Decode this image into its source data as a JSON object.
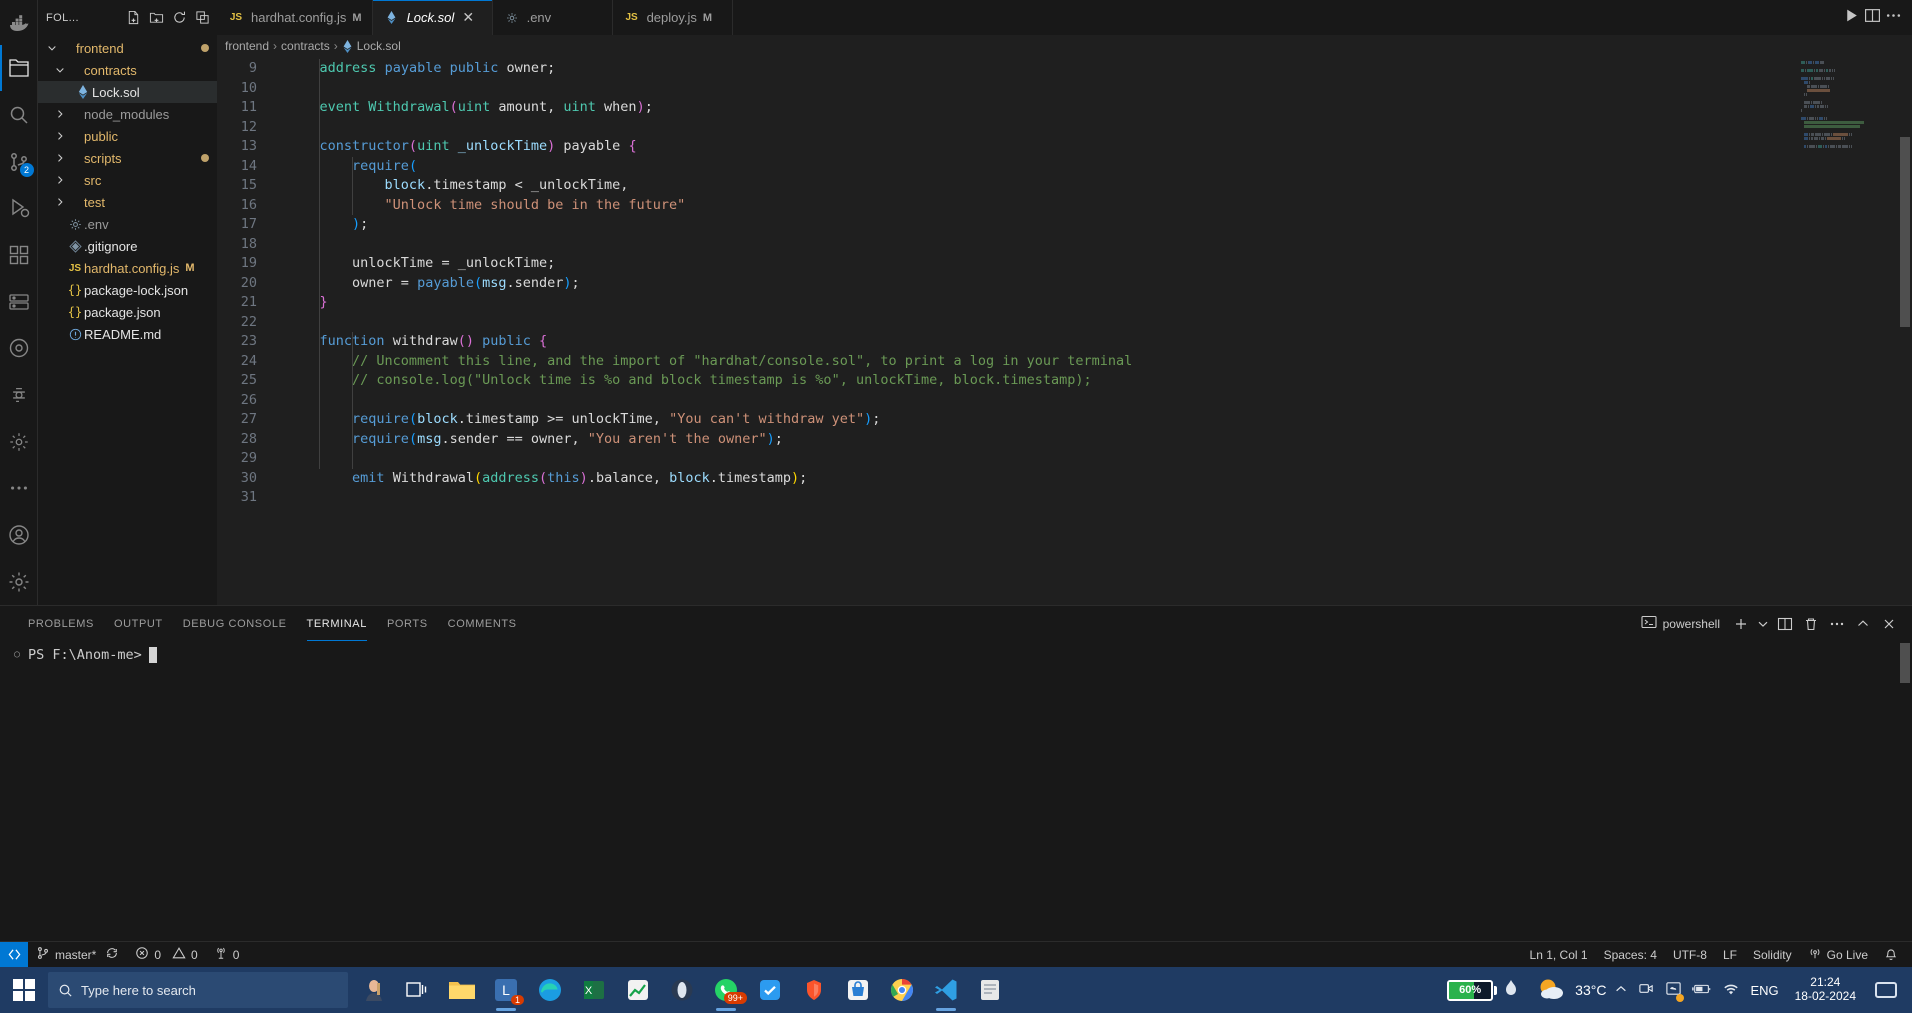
{
  "activity_bar": {
    "items": [
      {
        "name": "docker-icon",
        "label": "Docker"
      },
      {
        "name": "explorer-icon",
        "label": "Explorer"
      },
      {
        "name": "search-icon",
        "label": "Search"
      },
      {
        "name": "source-control-icon",
        "label": "Source Control",
        "badge": "2"
      },
      {
        "name": "run-debug-icon",
        "label": "Run and Debug"
      },
      {
        "name": "extensions-icon",
        "label": "Extensions"
      },
      {
        "name": "remote-explorer-icon",
        "label": "Remote Explorer"
      },
      {
        "name": "testing-icon",
        "label": "Testing"
      },
      {
        "name": "figma-icon",
        "label": "Figma"
      },
      {
        "name": "settings-gear-icon",
        "label": "Settings"
      },
      {
        "name": "more-actions-icon",
        "label": "More Actions"
      },
      {
        "name": "accounts-icon",
        "label": "Accounts"
      },
      {
        "name": "manage-icon",
        "label": "Manage"
      }
    ]
  },
  "sidebar": {
    "title": "FOL...",
    "actions": [
      {
        "name": "new-file-button",
        "label": "New File"
      },
      {
        "name": "new-folder-button",
        "label": "New Folder"
      },
      {
        "name": "refresh-explorer-button",
        "label": "Refresh Explorer"
      },
      {
        "name": "collapse-folders-button",
        "label": "Collapse Folders"
      }
    ],
    "tree": [
      {
        "label": "frontend",
        "depth": 0,
        "kind": "folder",
        "state": "expanded",
        "dirty": true,
        "mod": ""
      },
      {
        "label": "contracts",
        "depth": 1,
        "kind": "folder",
        "state": "expanded",
        "dirty": false,
        "mod": ""
      },
      {
        "label": "Lock.sol",
        "depth": 2,
        "kind": "solidity",
        "state": "file",
        "dirty": false,
        "mod": "",
        "selected": true
      },
      {
        "label": "node_modules",
        "depth": 1,
        "kind": "folder",
        "state": "collapsed",
        "dirty": false,
        "mod": ""
      },
      {
        "label": "public",
        "depth": 1,
        "kind": "folder",
        "state": "collapsed",
        "dirty": false,
        "mod": ""
      },
      {
        "label": "scripts",
        "depth": 1,
        "kind": "folder",
        "state": "collapsed",
        "dirty": true,
        "mod": ""
      },
      {
        "label": "src",
        "depth": 1,
        "kind": "folder",
        "state": "collapsed",
        "dirty": false,
        "mod": ""
      },
      {
        "label": "test",
        "depth": 1,
        "kind": "folder",
        "state": "collapsed",
        "dirty": false,
        "mod": ""
      },
      {
        "label": ".env",
        "depth": 1,
        "kind": "env",
        "state": "file",
        "dirty": false,
        "mod": ""
      },
      {
        "label": ".gitignore",
        "depth": 1,
        "kind": "git",
        "state": "file",
        "dirty": false,
        "mod": ""
      },
      {
        "label": "hardhat.config.js",
        "depth": 1,
        "kind": "js",
        "state": "file",
        "dirty": false,
        "mod": "M"
      },
      {
        "label": "package-lock.json",
        "depth": 1,
        "kind": "json",
        "state": "file",
        "dirty": false,
        "mod": ""
      },
      {
        "label": "package.json",
        "depth": 1,
        "kind": "json",
        "state": "file",
        "dirty": false,
        "mod": ""
      },
      {
        "label": "README.md",
        "depth": 1,
        "kind": "md",
        "state": "file",
        "dirty": false,
        "mod": ""
      }
    ]
  },
  "editor": {
    "tabs": [
      {
        "label": "hardhat.config.js",
        "icon": "js-icon",
        "mod": "M",
        "active": false,
        "italic": false,
        "closable": false
      },
      {
        "label": "Lock.sol",
        "icon": "solidity-icon",
        "mod": "",
        "active": true,
        "italic": true,
        "closable": true
      },
      {
        "label": ".env",
        "icon": "gear-icon",
        "mod": "",
        "active": false,
        "italic": false,
        "closable": false
      },
      {
        "label": "deploy.js",
        "icon": "js-icon",
        "mod": "M",
        "active": false,
        "italic": false,
        "closable": false
      }
    ],
    "tab_actions": [
      {
        "name": "run-file-button",
        "label": "Run"
      },
      {
        "name": "split-editor-button",
        "label": "Split Editor Right"
      },
      {
        "name": "more-actions-button",
        "label": "More Actions..."
      }
    ],
    "breadcrumb": [
      "frontend",
      "contracts",
      "Lock.sol"
    ],
    "first_line": 9,
    "lines": [
      {
        "n": 9,
        "indent": 1,
        "tokens": [
          {
            "t": "address",
            "c": "t-type"
          },
          {
            "t": " ",
            "c": "t-plain"
          },
          {
            "t": "payable",
            "c": "t-ctrl"
          },
          {
            "t": " ",
            "c": "t-plain"
          },
          {
            "t": "public",
            "c": "t-ctrl"
          },
          {
            "t": " owner;",
            "c": "t-id"
          }
        ]
      },
      {
        "n": 10,
        "indent": 0,
        "tokens": []
      },
      {
        "n": 11,
        "indent": 1,
        "tokens": [
          {
            "t": "event",
            "c": "t-type"
          },
          {
            "t": " ",
            "c": "t-plain"
          },
          {
            "t": "Withdrawal",
            "c": "t-type"
          },
          {
            "t": "(",
            "c": "t-p2"
          },
          {
            "t": "uint",
            "c": "t-type"
          },
          {
            "t": " amount",
            "c": "t-id"
          },
          {
            "t": ", ",
            "c": "t-id"
          },
          {
            "t": "uint",
            "c": "t-type"
          },
          {
            "t": " when",
            "c": "t-id"
          },
          {
            "t": ")",
            "c": "t-p2"
          },
          {
            "t": ";",
            "c": "t-id"
          }
        ]
      },
      {
        "n": 12,
        "indent": 0,
        "tokens": []
      },
      {
        "n": 13,
        "indent": 1,
        "tokens": [
          {
            "t": "constructor",
            "c": "t-ctrl"
          },
          {
            "t": "(",
            "c": "t-p2"
          },
          {
            "t": "uint",
            "c": "t-type"
          },
          {
            "t": " _unlockTime",
            "c": "t-var"
          },
          {
            "t": ")",
            "c": "t-p2"
          },
          {
            "t": " ",
            "c": "t-plain"
          },
          {
            "t": "payable",
            "c": "t-id"
          },
          {
            "t": " ",
            "c": "t-plain"
          },
          {
            "t": "{",
            "c": "t-p2"
          }
        ]
      },
      {
        "n": 14,
        "indent": 2,
        "tokens": [
          {
            "t": "require",
            "c": "t-ctrl"
          },
          {
            "t": "(",
            "c": "t-p3"
          }
        ]
      },
      {
        "n": 15,
        "indent": 3,
        "tokens": [
          {
            "t": "block",
            "c": "t-var"
          },
          {
            "t": ".timestamp",
            "c": "t-id"
          },
          {
            "t": " < ",
            "c": "t-id"
          },
          {
            "t": "_unlockTime",
            "c": "t-id"
          },
          {
            "t": ",",
            "c": "t-id"
          }
        ]
      },
      {
        "n": 16,
        "indent": 3,
        "tokens": [
          {
            "t": "\"Unlock time should be in the future\"",
            "c": "t-str"
          }
        ]
      },
      {
        "n": 17,
        "indent": 2,
        "tokens": [
          {
            "t": ")",
            "c": "t-p3"
          },
          {
            "t": ";",
            "c": "t-id"
          }
        ]
      },
      {
        "n": 18,
        "indent": 0,
        "tokens": []
      },
      {
        "n": 19,
        "indent": 2,
        "tokens": [
          {
            "t": "unlockTime",
            "c": "t-id"
          },
          {
            "t": " = ",
            "c": "t-id"
          },
          {
            "t": "_unlockTime",
            "c": "t-id"
          },
          {
            "t": ";",
            "c": "t-id"
          }
        ]
      },
      {
        "n": 20,
        "indent": 2,
        "tokens": [
          {
            "t": "owner",
            "c": "t-id"
          },
          {
            "t": " = ",
            "c": "t-id"
          },
          {
            "t": "payable",
            "c": "t-ctrl"
          },
          {
            "t": "(",
            "c": "t-p3"
          },
          {
            "t": "msg",
            "c": "t-var"
          },
          {
            "t": ".sender",
            "c": "t-id"
          },
          {
            "t": ")",
            "c": "t-p3"
          },
          {
            "t": ";",
            "c": "t-id"
          }
        ]
      },
      {
        "n": 21,
        "indent": 1,
        "tokens": [
          {
            "t": "}",
            "c": "t-p2"
          }
        ]
      },
      {
        "n": 22,
        "indent": 0,
        "tokens": []
      },
      {
        "n": 23,
        "indent": 1,
        "tokens": [
          {
            "t": "function",
            "c": "t-ctrl"
          },
          {
            "t": " ",
            "c": "t-plain"
          },
          {
            "t": "withdraw",
            "c": "t-id"
          },
          {
            "t": "()",
            "c": "t-p2"
          },
          {
            "t": " ",
            "c": "t-plain"
          },
          {
            "t": "public",
            "c": "t-ctrl"
          },
          {
            "t": " ",
            "c": "t-plain"
          },
          {
            "t": "{",
            "c": "t-p2"
          }
        ]
      },
      {
        "n": 24,
        "indent": 2,
        "tokens": [
          {
            "t": "// Uncomment this line, and the import of \"hardhat/console.sol\", to print a log in your terminal",
            "c": "t-cmt"
          }
        ]
      },
      {
        "n": 25,
        "indent": 2,
        "tokens": [
          {
            "t": "// console.log(\"Unlock time is %o and block timestamp is %o\", unlockTime, block.timestamp);",
            "c": "t-cmt"
          }
        ]
      },
      {
        "n": 26,
        "indent": 0,
        "tokens": []
      },
      {
        "n": 27,
        "indent": 2,
        "tokens": [
          {
            "t": "require",
            "c": "t-ctrl"
          },
          {
            "t": "(",
            "c": "t-p3"
          },
          {
            "t": "block",
            "c": "t-var"
          },
          {
            "t": ".timestamp",
            "c": "t-id"
          },
          {
            "t": " >= ",
            "c": "t-id"
          },
          {
            "t": "unlockTime",
            "c": "t-id"
          },
          {
            "t": ", ",
            "c": "t-id"
          },
          {
            "t": "\"You can't withdraw yet\"",
            "c": "t-str"
          },
          {
            "t": ")",
            "c": "t-p3"
          },
          {
            "t": ";",
            "c": "t-id"
          }
        ]
      },
      {
        "n": 28,
        "indent": 2,
        "tokens": [
          {
            "t": "require",
            "c": "t-ctrl"
          },
          {
            "t": "(",
            "c": "t-p3"
          },
          {
            "t": "msg",
            "c": "t-var"
          },
          {
            "t": ".sender",
            "c": "t-id"
          },
          {
            "t": " == ",
            "c": "t-id"
          },
          {
            "t": "owner",
            "c": "t-id"
          },
          {
            "t": ", ",
            "c": "t-id"
          },
          {
            "t": "\"You aren't the owner\"",
            "c": "t-str"
          },
          {
            "t": ")",
            "c": "t-p3"
          },
          {
            "t": ";",
            "c": "t-id"
          }
        ]
      },
      {
        "n": 29,
        "indent": 0,
        "tokens": []
      },
      {
        "n": 30,
        "indent": 2,
        "tokens": [
          {
            "t": "emit",
            "c": "t-ctrl"
          },
          {
            "t": " ",
            "c": "t-plain"
          },
          {
            "t": "Withdrawal",
            "c": "t-id"
          },
          {
            "t": "(",
            "c": "t-p1"
          },
          {
            "t": "address",
            "c": "t-type"
          },
          {
            "t": "(",
            "c": "t-p2"
          },
          {
            "t": "this",
            "c": "t-ctrl"
          },
          {
            "t": ")",
            "c": "t-p2"
          },
          {
            "t": ".balance",
            "c": "t-id"
          },
          {
            "t": ", ",
            "c": "t-id"
          },
          {
            "t": "block",
            "c": "t-var"
          },
          {
            "t": ".timestamp",
            "c": "t-id"
          },
          {
            "t": ")",
            "c": "t-p1"
          },
          {
            "t": ";",
            "c": "t-id"
          }
        ]
      },
      {
        "n": 31,
        "indent": 0,
        "tokens": []
      }
    ]
  },
  "panel": {
    "tabs": [
      {
        "label": "PROBLEMS",
        "active": false
      },
      {
        "label": "OUTPUT",
        "active": false
      },
      {
        "label": "DEBUG CONSOLE",
        "active": false
      },
      {
        "label": "TERMINAL",
        "active": true
      },
      {
        "label": "PORTS",
        "active": false
      },
      {
        "label": "COMMENTS",
        "active": false
      }
    ],
    "shell_name": "powershell",
    "actions": [
      {
        "name": "new-terminal-button",
        "label": "New Terminal"
      },
      {
        "name": "terminal-profile-dropdown-icon",
        "label": "Launch Profile"
      },
      {
        "name": "split-terminal-button",
        "label": "Split Terminal"
      },
      {
        "name": "kill-terminal-button",
        "label": "Kill Terminal"
      },
      {
        "name": "panel-more-actions-button",
        "label": "Views and More Actions"
      },
      {
        "name": "maximize-panel-button",
        "label": "Maximize Panel Size"
      },
      {
        "name": "close-panel-button",
        "label": "Close Panel"
      }
    ],
    "terminal_prompt": "PS F:\\Anom-me>"
  },
  "status_bar": {
    "remote_icon": "remote-window-icon",
    "branch": "master*",
    "sync_icon": "sync-icon",
    "errors": "0",
    "warnings": "0",
    "ports": "0",
    "cursor": "Ln 1, Col 1",
    "indentation": "Spaces: 4",
    "encoding": "UTF-8",
    "eol": "LF",
    "language": "Solidity",
    "go_live": "Go Live",
    "bell_icon": "bell-icon"
  },
  "taskbar": {
    "search_placeholder": "Type here to search",
    "apps": [
      {
        "name": "cortana-icon",
        "label": "Cortana"
      },
      {
        "name": "task-view-icon",
        "label": "Task View"
      },
      {
        "name": "file-explorer-icon",
        "label": "File Explorer"
      },
      {
        "name": "lockdown-browser-icon",
        "label": "Lockdown Browser",
        "badge": "1"
      },
      {
        "name": "edge-icon",
        "label": "Microsoft Edge"
      },
      {
        "name": "excel-icon",
        "label": "Excel"
      },
      {
        "name": "stocks-icon",
        "label": "Stocks"
      },
      {
        "name": "opera-icon",
        "label": "Opera"
      },
      {
        "name": "whatsapp-icon",
        "label": "WhatsApp",
        "badge": "99+"
      },
      {
        "name": "todoist-icon",
        "label": "Todoist"
      },
      {
        "name": "brave-icon",
        "label": "Brave"
      },
      {
        "name": "store-icon",
        "label": "Microsoft Store"
      },
      {
        "name": "chrome-icon",
        "label": "Google Chrome"
      },
      {
        "name": "vscode-icon",
        "label": "Visual Studio Code"
      },
      {
        "name": "notes-icon",
        "label": "Notes"
      }
    ],
    "battery_percent": "60%",
    "temperature": "33°C",
    "language": "ENG",
    "time": "21:24",
    "date": "18-02-2024",
    "tray_icons": [
      {
        "name": "chevron-up-icon",
        "label": "Show hidden icons"
      },
      {
        "name": "camera-icon",
        "label": "Camera"
      },
      {
        "name": "onedrive-icon",
        "label": "OneDrive"
      },
      {
        "name": "battery-tray-icon",
        "label": "Battery"
      },
      {
        "name": "wifi-icon",
        "label": "Network"
      }
    ],
    "accent": "#1f3b63",
    "battery_color": "#2bb24c"
  }
}
